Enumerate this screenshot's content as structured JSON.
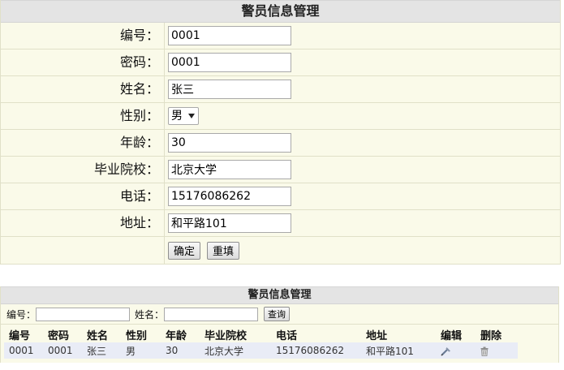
{
  "form": {
    "title": "警员信息管理",
    "fields": [
      {
        "label": "编号：",
        "value": "0001"
      },
      {
        "label": "密码：",
        "value": "0001"
      },
      {
        "label": "姓名：",
        "value": "张三"
      },
      {
        "label": "性别：",
        "selected": "男"
      },
      {
        "label": "年龄：",
        "value": "30"
      },
      {
        "label": "毕业院校：",
        "value": "北京大学"
      },
      {
        "label": "电话：",
        "value": "15176086262"
      },
      {
        "label": "地址：",
        "value": "和平路101"
      }
    ],
    "buttons": {
      "confirm": "确定",
      "reset": "重填"
    }
  },
  "list": {
    "title": "警员信息管理",
    "search": {
      "id_label": "编号：",
      "id_value": "",
      "name_label": "姓名：",
      "name_value": "",
      "query_label": "查询"
    },
    "columns": [
      "编号",
      "密码",
      "姓名",
      "性别",
      "年龄",
      "毕业院校",
      "电话",
      "地址",
      "编辑",
      "删除"
    ],
    "rows": [
      {
        "id": "0001",
        "password": "0001",
        "name": "张三",
        "gender": "男",
        "age": "30",
        "school": "北京大学",
        "phone": "15176086262",
        "address": "和平路101",
        "edit_icon": "edit-icon",
        "delete_icon": "trash-icon"
      }
    ]
  },
  "icons": {
    "select_arrow": "chevron-down-icon"
  },
  "colors": {
    "header_bg": "#e4e4e4",
    "panel_bg": "#fafae9",
    "line": "#e0e0c8",
    "row_bg": "#e9ecf6"
  }
}
